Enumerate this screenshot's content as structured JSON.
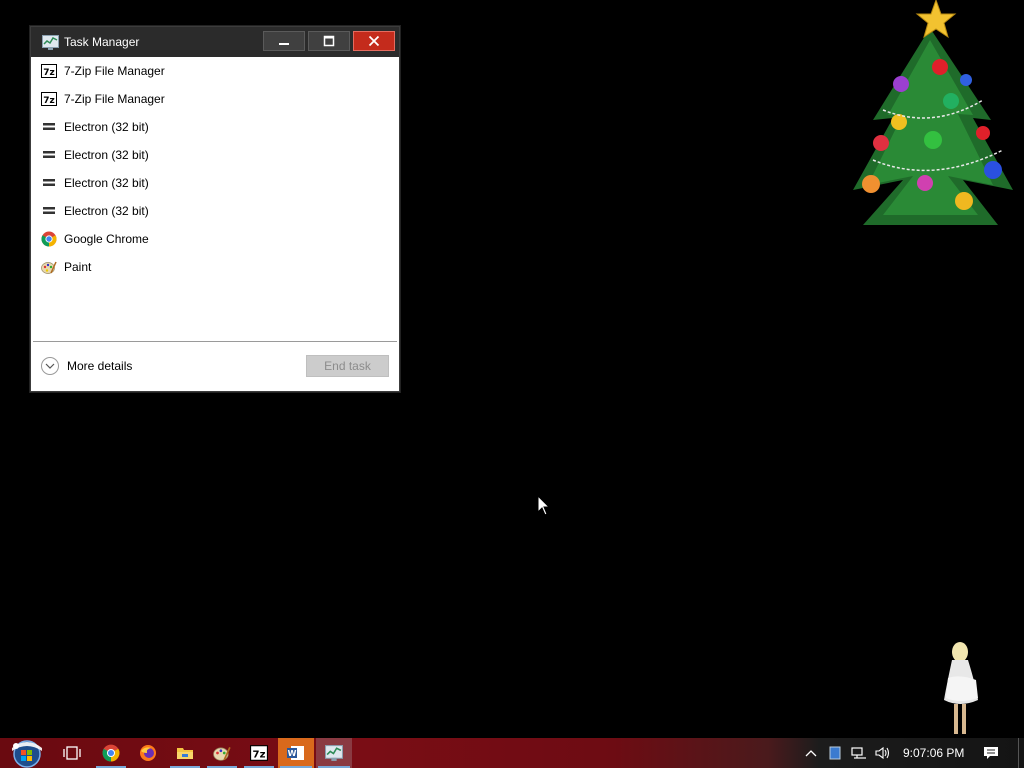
{
  "window": {
    "title": "Task Manager",
    "controls": {
      "minimize": "minimize",
      "maximize": "maximize",
      "close": "close"
    }
  },
  "processes": [
    {
      "name": "7-Zip File Manager",
      "icon": "7zip-icon"
    },
    {
      "name": "7-Zip File Manager",
      "icon": "7zip-icon"
    },
    {
      "name": "Electron (32 bit)",
      "icon": "electron-icon"
    },
    {
      "name": "Electron (32 bit)",
      "icon": "electron-icon"
    },
    {
      "name": "Electron (32 bit)",
      "icon": "electron-icon"
    },
    {
      "name": "Electron (32 bit)",
      "icon": "electron-icon"
    },
    {
      "name": "Google Chrome",
      "icon": "chrome-icon"
    },
    {
      "name": "Paint",
      "icon": "paint-icon"
    }
  ],
  "footer": {
    "more_details_label": "More details",
    "end_task_label": "End task",
    "end_task_enabled": false
  },
  "taskbar": {
    "items": [
      {
        "name": "start-button",
        "icon": "windows-orb-icon"
      },
      {
        "name": "task-view-button",
        "icon": "task-view-icon"
      },
      {
        "name": "chrome",
        "icon": "chrome-icon",
        "active": true
      },
      {
        "name": "firefox",
        "icon": "firefox-icon"
      },
      {
        "name": "file-explorer",
        "icon": "folder-icon",
        "active": true
      },
      {
        "name": "paint",
        "icon": "paint-icon",
        "active": true
      },
      {
        "name": "7zip",
        "icon": "7zip-icon",
        "active": true
      },
      {
        "name": "word",
        "icon": "word-icon",
        "active": true
      },
      {
        "name": "task-manager",
        "icon": "task-manager-icon",
        "active": true
      }
    ],
    "tray": {
      "clock": "9:07:06 PM",
      "icons": [
        "chevron-up-icon",
        "tablet-icon",
        "network-icon",
        "volume-icon",
        "notification-icon"
      ]
    }
  },
  "colors": {
    "titlebar": "#2b2b2b",
    "close_button": "#c42b1c",
    "taskbar_accent": "#7a0d15",
    "active_indicator": "#79a9d9"
  }
}
